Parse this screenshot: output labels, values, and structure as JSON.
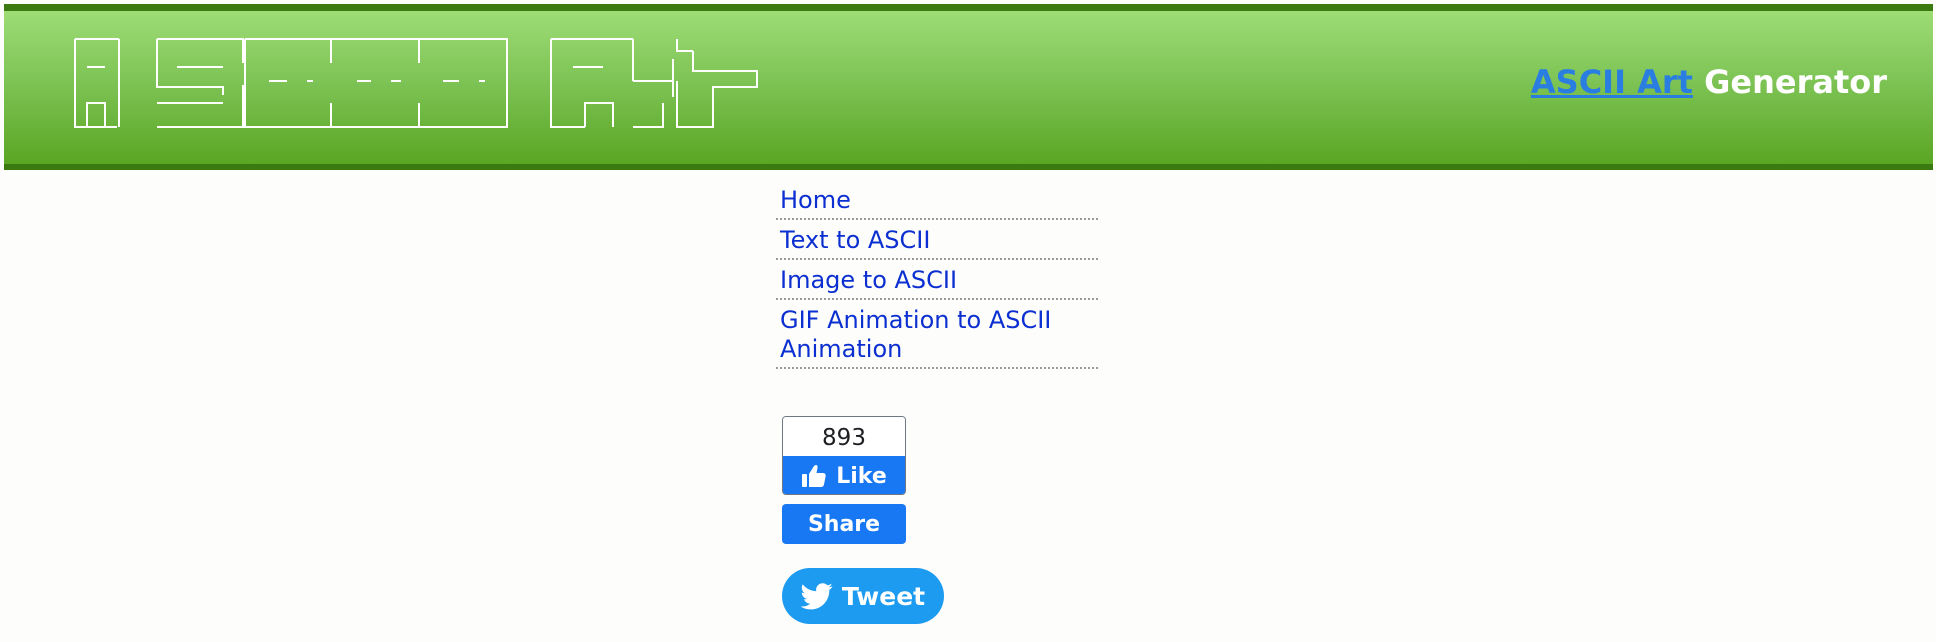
{
  "header": {
    "logo_alt": "ASCII Art",
    "brand_link": "ASCII Art",
    "brand_suffix": " Generator"
  },
  "nav": {
    "items": [
      {
        "label": "Home"
      },
      {
        "label": "Text to ASCII"
      },
      {
        "label": "Image to ASCII"
      },
      {
        "label": "GIF Animation to ASCII Animation"
      }
    ]
  },
  "social": {
    "like_count": "893",
    "like_label": "Like",
    "share_label": "Share",
    "tweet_label": "Tweet"
  },
  "icons": {
    "thumbs_up": "thumbs-up-icon",
    "twitter": "twitter-bird-icon"
  },
  "colors": {
    "header_top": "#9edc76",
    "header_bottom": "#5aa624",
    "header_border": "#3b7a10",
    "brand_link": "#2a7de1",
    "nav_link": "#0b2fd0",
    "facebook_blue": "#1877f2",
    "twitter_blue": "#1d9bf0"
  }
}
